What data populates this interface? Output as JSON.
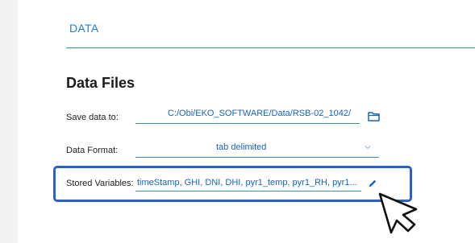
{
  "tabs": {
    "active_label": "DATA"
  },
  "section": {
    "title": "Data Files"
  },
  "save_data": {
    "label": "Save data to:",
    "value": "C:/Obi/EKO_SOFTWARE/Data/RSB-02_1042/",
    "icon": "folder-icon"
  },
  "data_format": {
    "label": "Data Format:",
    "value": "tab delimited",
    "icon": "chevron-down-icon"
  },
  "stored_variables": {
    "label": "Stored Variables:",
    "value": "timeStamp, GHI, DNI, DHI, pyr1_temp, pyr1_RH, pyr1...",
    "icon": "pencil-icon"
  },
  "colors": {
    "accent": "#1e7fd0",
    "field_text": "#1565c0",
    "highlight": "#2a62c2"
  }
}
